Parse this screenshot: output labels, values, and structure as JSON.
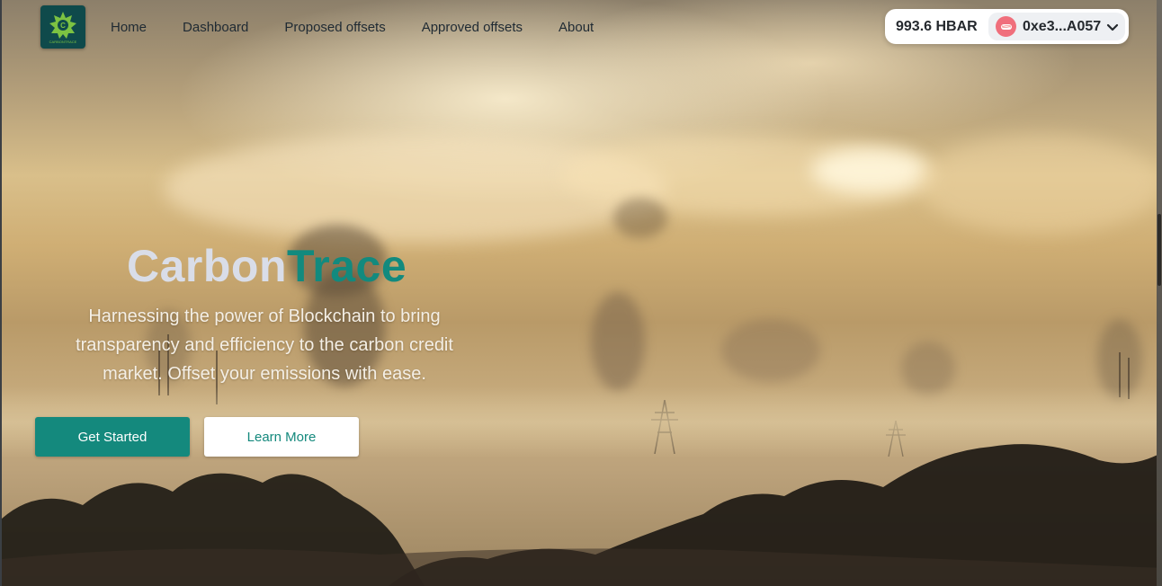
{
  "brand": {
    "logo_text": "CARBONTRACE"
  },
  "nav": {
    "items": [
      "Home",
      "Dashboard",
      "Proposed offsets",
      "Approved offsets",
      "About"
    ]
  },
  "wallet": {
    "balance": "993.6 HBAR",
    "account": "0xe3...A057",
    "avatar_icon": "sushi-icon",
    "dropdown_icon": "chevron-down-icon"
  },
  "hero": {
    "title_part1": "Carbon",
    "title_part2": "Trace",
    "subtitle": "Harnessing the power of Blockchain to bring transparency and efficiency to the carbon credit market. Offset your emissions with ease.",
    "primary_button": "Get Started",
    "secondary_button": "Learn More"
  },
  "colors": {
    "accent": "#14897d",
    "logo_bg": "#0f4a4b",
    "title_light": "#d9dde8"
  }
}
